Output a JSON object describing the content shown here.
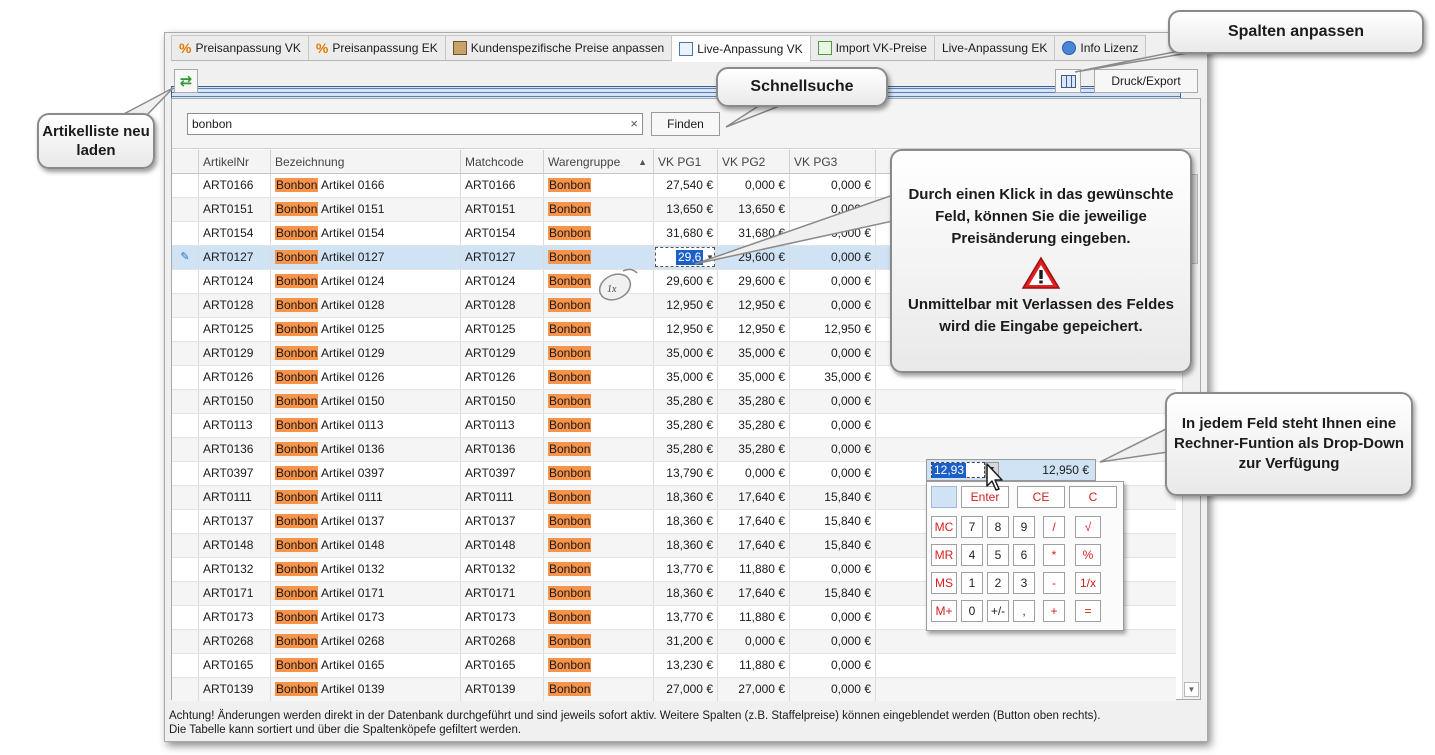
{
  "tabs": [
    {
      "label": "Preisanpassung VK",
      "icon": "percent-icon"
    },
    {
      "label": "Preisanpassung EK",
      "icon": "percent-icon"
    },
    {
      "label": "Kundenspezifische Preise anpassen",
      "icon": "book-icon"
    },
    {
      "label": "Live-Anpassung VK",
      "icon": "calculator-icon",
      "active": true
    },
    {
      "label": "Import VK-Preise",
      "icon": "import-icon"
    },
    {
      "label": "Live-Anpassung EK",
      "icon": "grid-icon"
    },
    {
      "label": "Info Lizenz",
      "icon": "info-icon"
    }
  ],
  "toolbar": {
    "print_label": "Druck/Export"
  },
  "search": {
    "value": "bonbon",
    "clear": "×",
    "find_label": "Finden"
  },
  "columns": [
    "ArtikelNr",
    "Bezeichnung",
    "Matchcode",
    "Warengruppe",
    "VK PG1",
    "VK PG2",
    "VK PG3"
  ],
  "highlight_word": "Bonbon",
  "rows": [
    {
      "nr": "ART0166",
      "bez": "Artikel 0166",
      "mc": "ART0166",
      "wg": "Bonbon",
      "p1": "27,540 €",
      "p2": "0,000 €",
      "p3": "0,000 €"
    },
    {
      "nr": "ART0151",
      "bez": "Artikel 0151",
      "mc": "ART0151",
      "wg": "Bonbon",
      "p1": "13,650 €",
      "p2": "13,650 €",
      "p3": "0,000 €"
    },
    {
      "nr": "ART0154",
      "bez": "Artikel 0154",
      "mc": "ART0154",
      "wg": "Bonbon",
      "p1": "31,680 €",
      "p2": "31,680 €",
      "p3": "0,000 €"
    },
    {
      "nr": "ART0127",
      "bez": "Artikel 0127",
      "mc": "ART0127",
      "wg": "Bonbon",
      "p1": "29,6",
      "p2": "29,600 €",
      "p3": "0,000 €",
      "editing": true
    },
    {
      "nr": "ART0124",
      "bez": "Artikel 0124",
      "mc": "ART0124",
      "wg": "Bonbon",
      "p1": "29,600 €",
      "p2": "29,600 €",
      "p3": "0,000 €"
    },
    {
      "nr": "ART0128",
      "bez": "Artikel 0128",
      "mc": "ART0128",
      "wg": "Bonbon",
      "p1": "12,950 €",
      "p2": "12,950 €",
      "p3": "0,000 €"
    },
    {
      "nr": "ART0125",
      "bez": "Artikel 0125",
      "mc": "ART0125",
      "wg": "Bonbon",
      "p1": "12,950 €",
      "p2": "12,950 €",
      "p3": "12,950 €"
    },
    {
      "nr": "ART0129",
      "bez": "Artikel 0129",
      "mc": "ART0129",
      "wg": "Bonbon",
      "p1": "35,000 €",
      "p2": "35,000 €",
      "p3": "0,000 €"
    },
    {
      "nr": "ART0126",
      "bez": "Artikel 0126",
      "mc": "ART0126",
      "wg": "Bonbon",
      "p1": "35,000 €",
      "p2": "35,000 €",
      "p3": "35,000 €"
    },
    {
      "nr": "ART0150",
      "bez": "Artikel 0150",
      "mc": "ART0150",
      "wg": "Bonbon",
      "p1": "35,280 €",
      "p2": "35,280 €",
      "p3": "0,000 €"
    },
    {
      "nr": "ART0113",
      "bez": "Artikel 0113",
      "mc": "ART0113",
      "wg": "Bonbon",
      "p1": "35,280 €",
      "p2": "35,280 €",
      "p3": "0,000 €"
    },
    {
      "nr": "ART0136",
      "bez": "Artikel 0136",
      "mc": "ART0136",
      "wg": "Bonbon",
      "p1": "35,280 €",
      "p2": "35,280 €",
      "p3": "0,000 €"
    },
    {
      "nr": "ART0397",
      "bez": "Artikel 0397",
      "mc": "ART0397",
      "wg": "Bonbon",
      "p1": "13,790 €",
      "p2": "0,000 €",
      "p3": "0,000 €"
    },
    {
      "nr": "ART0111",
      "bez": "Artikel 0111",
      "mc": "ART0111",
      "wg": "Bonbon",
      "p1": "18,360 €",
      "p2": "17,640 €",
      "p3": "15,840 €"
    },
    {
      "nr": "ART0137",
      "bez": "Artikel 0137",
      "mc": "ART0137",
      "wg": "Bonbon",
      "p1": "18,360 €",
      "p2": "17,640 €",
      "p3": "15,840 €"
    },
    {
      "nr": "ART0148",
      "bez": "Artikel 0148",
      "mc": "ART0148",
      "wg": "Bonbon",
      "p1": "18,360 €",
      "p2": "17,640 €",
      "p3": "15,840 €"
    },
    {
      "nr": "ART0132",
      "bez": "Artikel 0132",
      "mc": "ART0132",
      "wg": "Bonbon",
      "p1": "13,770 €",
      "p2": "11,880 €",
      "p3": "0,000 €"
    },
    {
      "nr": "ART0171",
      "bez": "Artikel 0171",
      "mc": "ART0171",
      "wg": "Bonbon",
      "p1": "18,360 €",
      "p2": "17,640 €",
      "p3": "15,840 €"
    },
    {
      "nr": "ART0173",
      "bez": "Artikel 0173",
      "mc": "ART0173",
      "wg": "Bonbon",
      "p1": "13,770 €",
      "p2": "11,880 €",
      "p3": "0,000 €"
    },
    {
      "nr": "ART0268",
      "bez": "Artikel 0268",
      "mc": "ART0268",
      "wg": "Bonbon",
      "p1": "31,200 €",
      "p2": "0,000 €",
      "p3": "0,000 €"
    },
    {
      "nr": "ART0165",
      "bez": "Artikel 0165",
      "mc": "ART0165",
      "wg": "Bonbon",
      "p1": "13,230 €",
      "p2": "11,880 €",
      "p3": "0,000 €"
    },
    {
      "nr": "ART0139",
      "bez": "Artikel 0139",
      "mc": "ART0139",
      "wg": "Bonbon",
      "p1": "27,000 €",
      "p2": "27,000 €",
      "p3": "0,000 €"
    }
  ],
  "footer": {
    "line1": "Achtung! Änderungen werden direkt in der Datenbank durchgeführt und sind jeweils sofort aktiv. Weitere Spalten (z.B. Staffelpreise) können eingeblendet werden (Button oben rechts).",
    "line2": "Die Tabelle kann sortiert und über die Spaltenköpefe gefiltert werden."
  },
  "callouts": {
    "spalten": "Spalten anpassen",
    "schnellsuche": "Schnellsuche",
    "artikelliste": "Artikelliste neu laden",
    "klick_1": "Durch einen Klick in das gewünschte Feld, können Sie die jeweilige Preisänderung eingeben.",
    "klick_2": "Unmittelbar mit Verlassen des Feldes wird die Eingabe gepeichert.",
    "rechner": "In jedem Feld steht Ihnen eine Rechner-Funtion als Drop-Down zur Verfügung"
  },
  "mouse_label": "1x",
  "calculator": {
    "input_value": "12,93",
    "field_value": "12,950 €",
    "buttons": [
      [
        "",
        "Enter",
        "CE",
        "C"
      ],
      [
        "MC",
        "7",
        "8",
        "9",
        "/",
        "√"
      ],
      [
        "MR",
        "4",
        "5",
        "6",
        "*",
        "%"
      ],
      [
        "MS",
        "1",
        "2",
        "3",
        "-",
        "1/x"
      ],
      [
        "M+",
        "0",
        "+/-",
        ",",
        "+",
        "="
      ]
    ]
  },
  "colors": {
    "highlight": "#f7944a",
    "selected_row": "#cfe3f4",
    "accent": "#1c5fc8"
  }
}
